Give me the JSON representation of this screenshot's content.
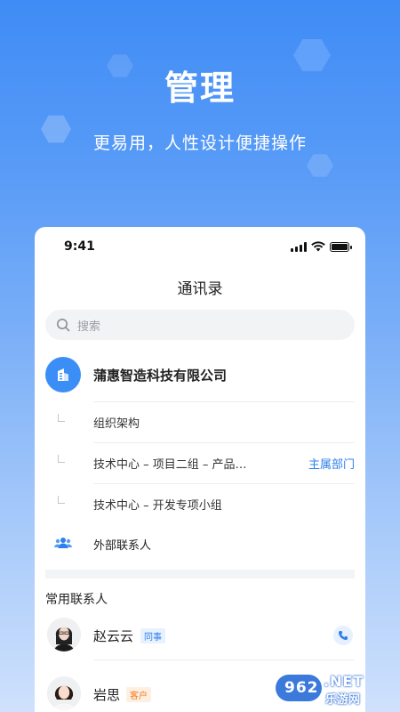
{
  "hero": {
    "title": "管理",
    "subtitle": "更易用，人性设计便捷操作"
  },
  "status_bar": {
    "time": "9:41"
  },
  "nav": {
    "title": "通讯录"
  },
  "search": {
    "placeholder": "搜索"
  },
  "company": {
    "name": "蒲惠智造科技有限公司"
  },
  "departments": [
    {
      "label": "组织架构",
      "tag": ""
    },
    {
      "label": "技术中心 – 项目二组 – 产品…",
      "tag": "主属部门"
    },
    {
      "label": "技术中心 – 开发专项小组",
      "tag": ""
    }
  ],
  "external": {
    "label": "外部联系人"
  },
  "frequent": {
    "title": "常用联系人",
    "contacts": [
      {
        "name": "赵云云",
        "badge": "同事",
        "badge_color": "#2f80ed"
      },
      {
        "name": "岩思",
        "badge": "客户",
        "badge_color": "#f07d1e"
      }
    ]
  },
  "watermark": {
    "logo": "962",
    "suffix": ".NET",
    "site": "乐游网"
  },
  "colors": {
    "accent": "#2f80ed",
    "hero_bg": "#3f8cf6",
    "company_logo": "#3a8ef6"
  }
}
